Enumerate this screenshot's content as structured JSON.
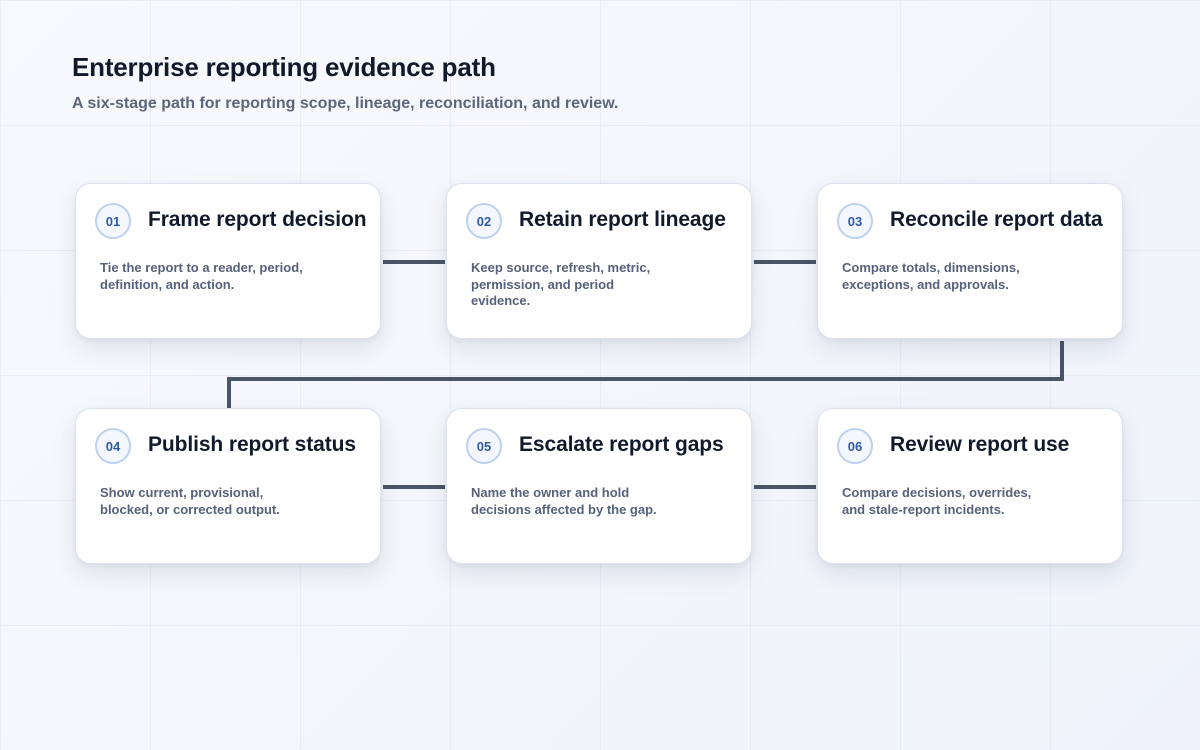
{
  "header": {
    "title": "Enterprise reporting evidence path",
    "subtitle": "A six-stage path for reporting scope, lineage, reconciliation, and review."
  },
  "colors": {
    "connector": "#4a5567",
    "badge_border": "#bcd0ef",
    "badge_text": "#2d5aa6",
    "title_text": "#111a2c",
    "body_text": "#56627a"
  },
  "stages": [
    {
      "number": "01",
      "title": "Frame report decision",
      "description": "Tie the report to a reader, period, definition, and action."
    },
    {
      "number": "02",
      "title": "Retain report lineage",
      "description": "Keep source, refresh, metric, permission, and period evidence."
    },
    {
      "number": "03",
      "title": "Reconcile report data",
      "description": "Compare totals, dimensions, exceptions, and approvals."
    },
    {
      "number": "04",
      "title": "Publish report status",
      "description": "Show current, provisional, blocked, or corrected output."
    },
    {
      "number": "05",
      "title": "Escalate report gaps",
      "description": "Name the owner and hold decisions affected by the gap."
    },
    {
      "number": "06",
      "title": "Review report use",
      "description": "Compare decisions, overrides, and stale-report incidents."
    }
  ]
}
